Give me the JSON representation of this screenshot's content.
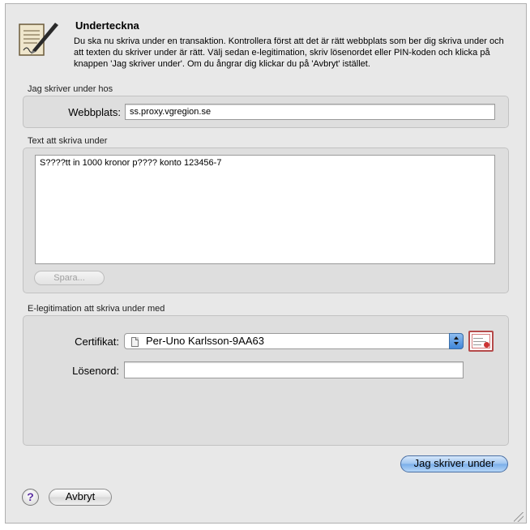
{
  "header": {
    "title": "Underteckna",
    "description": "Du ska nu skriva under en transaktion. Kontrollera först att det är rätt webbplats som ber dig skriva under och att texten du skriver under är rätt. Välj sedan e-legitimation, skriv lösenordet eller PIN-koden och klicka på knappen 'Jag skriver under'. Om du ångrar dig klickar du på 'Avbryt' istället.",
    "icon": "signing-document-pen-icon"
  },
  "site_section": {
    "label": "Jag skriver under hos",
    "field_label": "Webbplats:",
    "field_value": "ss.proxy.vgregion.se"
  },
  "text_section": {
    "label": "Text att skriva under",
    "text": "S????tt in 1000 kronor p???? konto 123456-7",
    "save_button": "Spara..."
  },
  "eid_section": {
    "label": "E-legitimation att skriva under med",
    "certificate_label": "Certifikat:",
    "certificate_value": "Per-Uno Karlsson-9AA63",
    "certificate_icon": "certificate-icon",
    "password_label": "Lösenord:",
    "password_value": ""
  },
  "buttons": {
    "sign": "Jag skriver under",
    "cancel": "Avbryt",
    "help": "?"
  },
  "colors": {
    "primary_button": "#79ade9",
    "window_bg": "#e8e8e8",
    "group_bg": "#dedede"
  }
}
